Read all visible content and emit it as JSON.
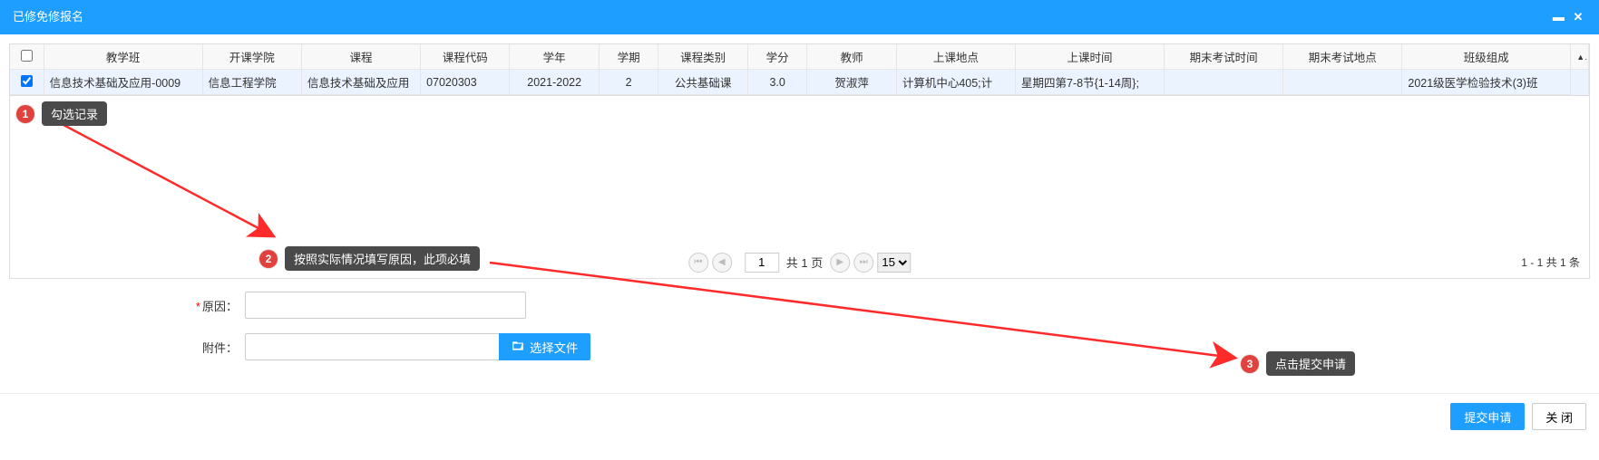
{
  "window": {
    "title": "已修免修报名"
  },
  "table": {
    "headers": [
      "教学班",
      "开课学院",
      "课程",
      "课程代码",
      "学年",
      "学期",
      "课程类别",
      "学分",
      "教师",
      "上课地点",
      "上课时间",
      "期末考试时间",
      "期末考试地点",
      "班级组成"
    ],
    "row": {
      "c0": "信息技术基础及应用-0009",
      "c1": "信息工程学院",
      "c2": "信息技术基础及应用",
      "c3": "07020303",
      "c4": "2021-2022",
      "c5": "2",
      "c6": "公共基础课",
      "c7": "3.0",
      "c8": "贺淑萍",
      "c9": "计算机中心405;计",
      "c10": "星期四第7-8节{1-14周};",
      "c11": "",
      "c12": "",
      "c13": "2021级医学检验技术(3)班"
    }
  },
  "pager": {
    "page_value": "1",
    "total_pages_text": "共 1 页",
    "page_size": "15",
    "range_text": "1 - 1   共 1 条"
  },
  "form": {
    "reason_label": "原因：",
    "attachment_label": "附件：",
    "choose_file_label": "选择文件"
  },
  "footer": {
    "submit_label": "提交申请",
    "close_label": "关 闭"
  },
  "annotations": {
    "a1": "勾选记录",
    "a2": "按照实际情况填写原因，此项必填",
    "a3": "点击提交申请"
  }
}
